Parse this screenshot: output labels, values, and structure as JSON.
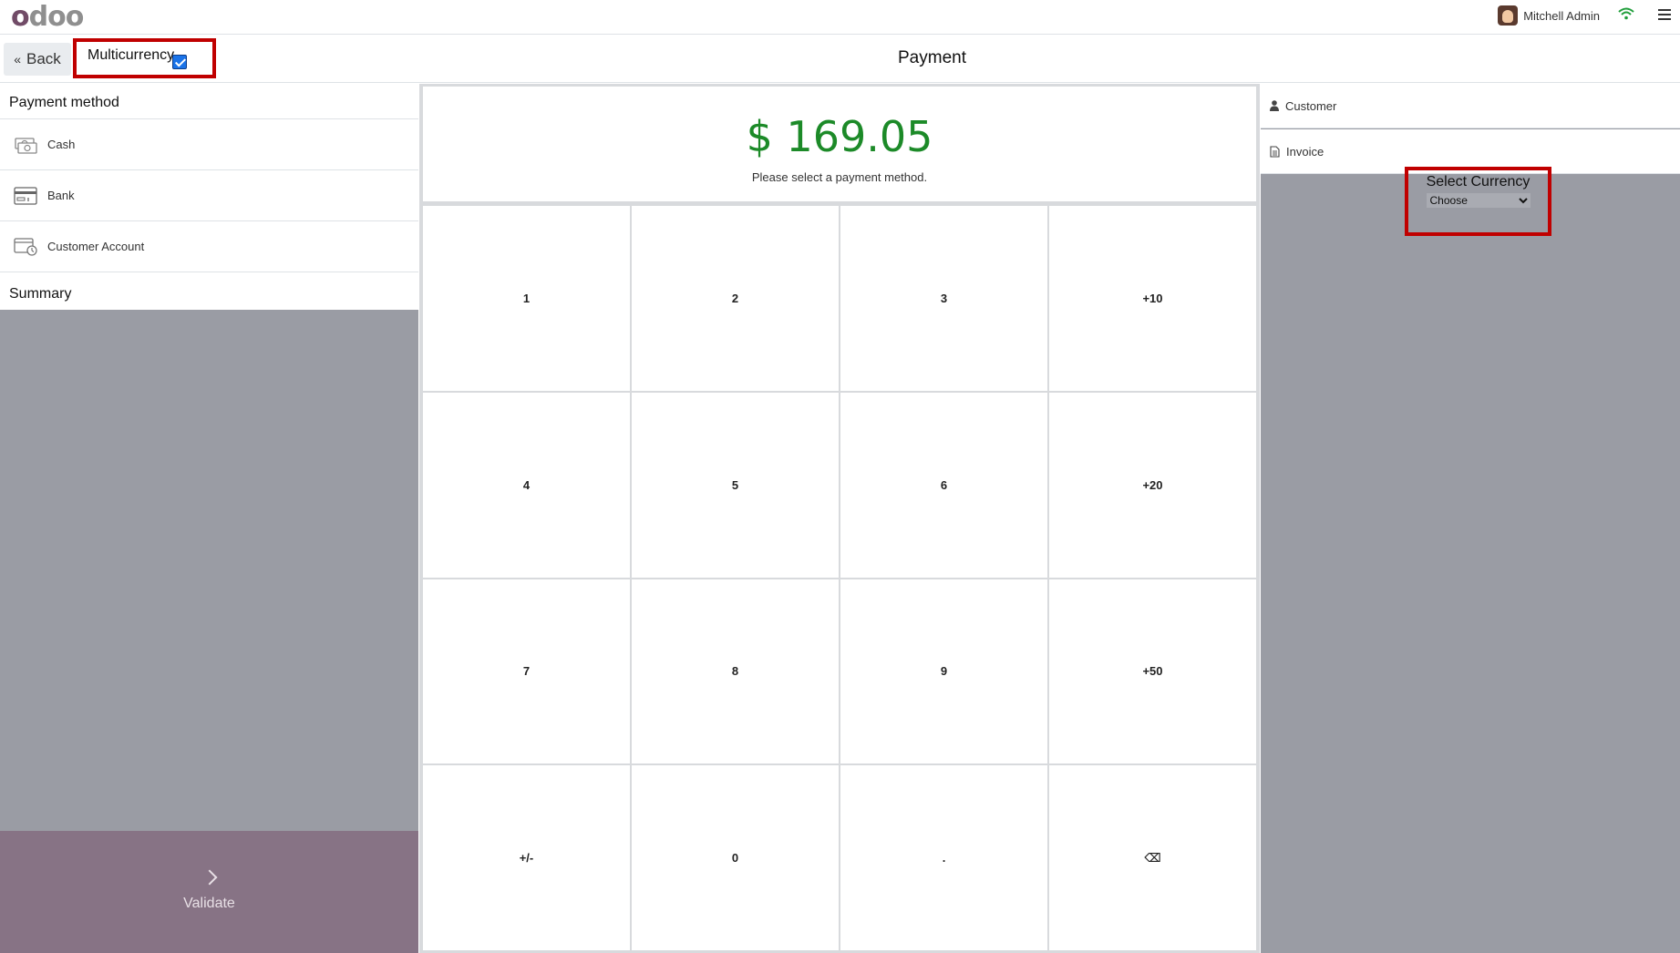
{
  "navbar": {
    "user_name": "Mitchell Admin"
  },
  "header": {
    "back_label": "Back",
    "multicurrency_label": "Multicurrency",
    "multicurrency_checked": true,
    "title": "Payment"
  },
  "left": {
    "payment_method_title": "Payment method",
    "methods": [
      {
        "label": "Cash",
        "icon": "cash-icon"
      },
      {
        "label": "Bank",
        "icon": "bank-card-icon"
      },
      {
        "label": "Customer Account",
        "icon": "customer-account-icon"
      }
    ],
    "summary_title": "Summary",
    "validate_label": "Validate"
  },
  "center": {
    "amount": "$ 169.05",
    "message": "Please select a payment method.",
    "keys": [
      "1",
      "2",
      "3",
      "+10",
      "4",
      "5",
      "6",
      "+20",
      "7",
      "8",
      "9",
      "+50",
      "+/-",
      "0",
      ".",
      "⌫"
    ]
  },
  "right": {
    "customer_label": "Customer",
    "invoice_label": "Invoice",
    "select_currency_label": "Select Currency",
    "currency_selected": "Choose"
  },
  "colors": {
    "amount": "#1c8a28",
    "validate_bg": "#877385",
    "highlight": "#c00000"
  }
}
